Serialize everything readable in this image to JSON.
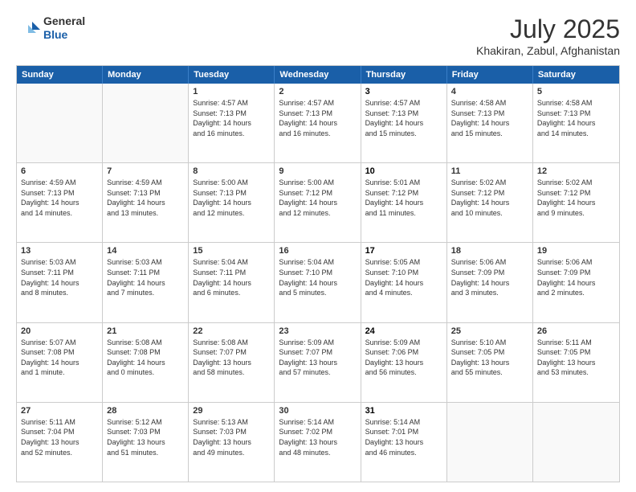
{
  "logo": {
    "line1": "General",
    "line2": "Blue"
  },
  "title": {
    "month_year": "July 2025",
    "location": "Khakiran, Zabul, Afghanistan"
  },
  "header_days": [
    "Sunday",
    "Monday",
    "Tuesday",
    "Wednesday",
    "Thursday",
    "Friday",
    "Saturday"
  ],
  "weeks": [
    [
      {
        "day": "",
        "content": ""
      },
      {
        "day": "",
        "content": ""
      },
      {
        "day": "1",
        "content": "Sunrise: 4:57 AM\nSunset: 7:13 PM\nDaylight: 14 hours\nand 16 minutes."
      },
      {
        "day": "2",
        "content": "Sunrise: 4:57 AM\nSunset: 7:13 PM\nDaylight: 14 hours\nand 16 minutes."
      },
      {
        "day": "3",
        "content": "Sunrise: 4:57 AM\nSunset: 7:13 PM\nDaylight: 14 hours\nand 15 minutes.",
        "is_thursday": true
      },
      {
        "day": "4",
        "content": "Sunrise: 4:58 AM\nSunset: 7:13 PM\nDaylight: 14 hours\nand 15 minutes."
      },
      {
        "day": "5",
        "content": "Sunrise: 4:58 AM\nSunset: 7:13 PM\nDaylight: 14 hours\nand 14 minutes."
      }
    ],
    [
      {
        "day": "6",
        "content": "Sunrise: 4:59 AM\nSunset: 7:13 PM\nDaylight: 14 hours\nand 14 minutes."
      },
      {
        "day": "7",
        "content": "Sunrise: 4:59 AM\nSunset: 7:13 PM\nDaylight: 14 hours\nand 13 minutes."
      },
      {
        "day": "8",
        "content": "Sunrise: 5:00 AM\nSunset: 7:13 PM\nDaylight: 14 hours\nand 12 minutes."
      },
      {
        "day": "9",
        "content": "Sunrise: 5:00 AM\nSunset: 7:12 PM\nDaylight: 14 hours\nand 12 minutes."
      },
      {
        "day": "10",
        "content": "Sunrise: 5:01 AM\nSunset: 7:12 PM\nDaylight: 14 hours\nand 11 minutes.",
        "is_thursday": true
      },
      {
        "day": "11",
        "content": "Sunrise: 5:02 AM\nSunset: 7:12 PM\nDaylight: 14 hours\nand 10 minutes."
      },
      {
        "day": "12",
        "content": "Sunrise: 5:02 AM\nSunset: 7:12 PM\nDaylight: 14 hours\nand 9 minutes."
      }
    ],
    [
      {
        "day": "13",
        "content": "Sunrise: 5:03 AM\nSunset: 7:11 PM\nDaylight: 14 hours\nand 8 minutes."
      },
      {
        "day": "14",
        "content": "Sunrise: 5:03 AM\nSunset: 7:11 PM\nDaylight: 14 hours\nand 7 minutes."
      },
      {
        "day": "15",
        "content": "Sunrise: 5:04 AM\nSunset: 7:11 PM\nDaylight: 14 hours\nand 6 minutes."
      },
      {
        "day": "16",
        "content": "Sunrise: 5:04 AM\nSunset: 7:10 PM\nDaylight: 14 hours\nand 5 minutes."
      },
      {
        "day": "17",
        "content": "Sunrise: 5:05 AM\nSunset: 7:10 PM\nDaylight: 14 hours\nand 4 minutes.",
        "is_thursday": true
      },
      {
        "day": "18",
        "content": "Sunrise: 5:06 AM\nSunset: 7:09 PM\nDaylight: 14 hours\nand 3 minutes."
      },
      {
        "day": "19",
        "content": "Sunrise: 5:06 AM\nSunset: 7:09 PM\nDaylight: 14 hours\nand 2 minutes."
      }
    ],
    [
      {
        "day": "20",
        "content": "Sunrise: 5:07 AM\nSunset: 7:08 PM\nDaylight: 14 hours\nand 1 minute."
      },
      {
        "day": "21",
        "content": "Sunrise: 5:08 AM\nSunset: 7:08 PM\nDaylight: 14 hours\nand 0 minutes."
      },
      {
        "day": "22",
        "content": "Sunrise: 5:08 AM\nSunset: 7:07 PM\nDaylight: 13 hours\nand 58 minutes."
      },
      {
        "day": "23",
        "content": "Sunrise: 5:09 AM\nSunset: 7:07 PM\nDaylight: 13 hours\nand 57 minutes."
      },
      {
        "day": "24",
        "content": "Sunrise: 5:09 AM\nSunset: 7:06 PM\nDaylight: 13 hours\nand 56 minutes.",
        "is_thursday": true
      },
      {
        "day": "25",
        "content": "Sunrise: 5:10 AM\nSunset: 7:05 PM\nDaylight: 13 hours\nand 55 minutes."
      },
      {
        "day": "26",
        "content": "Sunrise: 5:11 AM\nSunset: 7:05 PM\nDaylight: 13 hours\nand 53 minutes."
      }
    ],
    [
      {
        "day": "27",
        "content": "Sunrise: 5:11 AM\nSunset: 7:04 PM\nDaylight: 13 hours\nand 52 minutes."
      },
      {
        "day": "28",
        "content": "Sunrise: 5:12 AM\nSunset: 7:03 PM\nDaylight: 13 hours\nand 51 minutes."
      },
      {
        "day": "29",
        "content": "Sunrise: 5:13 AM\nSunset: 7:03 PM\nDaylight: 13 hours\nand 49 minutes."
      },
      {
        "day": "30",
        "content": "Sunrise: 5:14 AM\nSunset: 7:02 PM\nDaylight: 13 hours\nand 48 minutes."
      },
      {
        "day": "31",
        "content": "Sunrise: 5:14 AM\nSunset: 7:01 PM\nDaylight: 13 hours\nand 46 minutes.",
        "is_thursday": true
      },
      {
        "day": "",
        "content": ""
      },
      {
        "day": "",
        "content": ""
      }
    ]
  ]
}
